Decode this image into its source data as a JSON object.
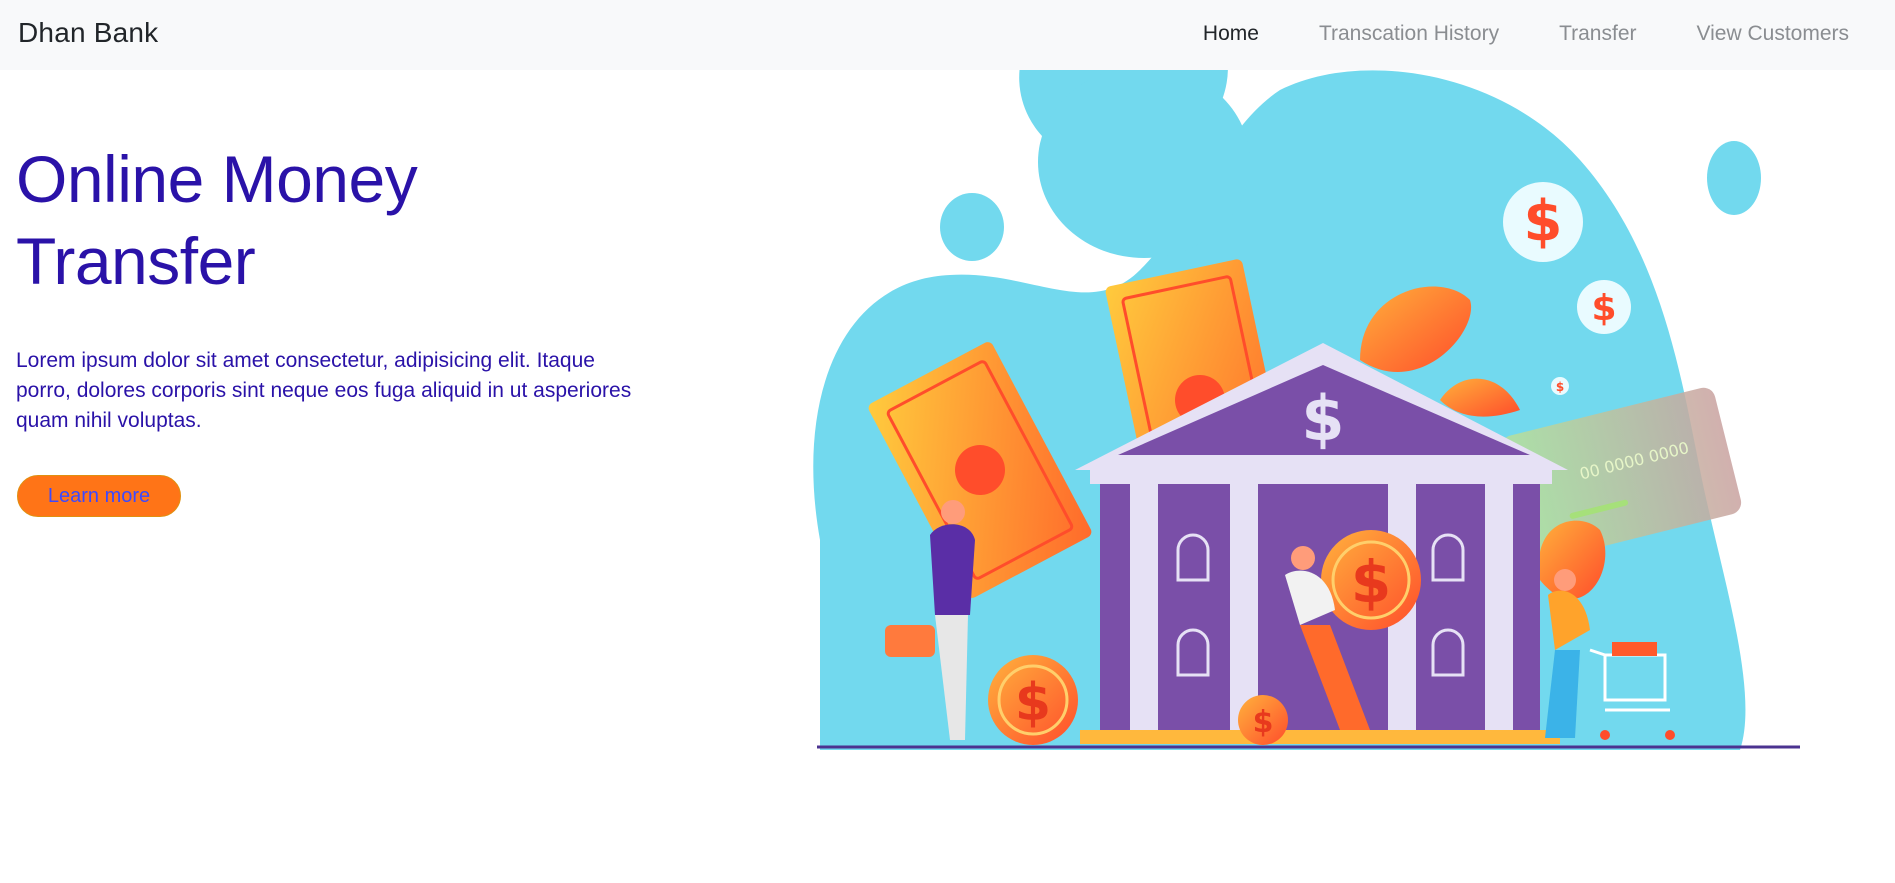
{
  "navbar": {
    "brand": "Dhan Bank",
    "links": [
      {
        "label": "Home",
        "active": true
      },
      {
        "label": "Transcation History",
        "active": false
      },
      {
        "label": "Transfer",
        "active": false
      },
      {
        "label": "View Customers",
        "active": false
      }
    ]
  },
  "hero": {
    "title_line1": "Online Money",
    "title_line2": "Transfer",
    "description": "Lorem ipsum dolor sit amet consectetur, adipisicing elit. Itaque porro, dolores corporis sint neque eos fuga aliquid in ut asperiores quam nihil voluptas.",
    "cta_label": "Learn more"
  },
  "illustration": {
    "dollar_sign": "$",
    "card_number": "00 0000 0000"
  },
  "colors": {
    "brand_blue": "#2a12a8",
    "accent_orange": "#ff7417",
    "sky_blob": "#72d9ee",
    "bank_purple": "#7a4fa8"
  }
}
